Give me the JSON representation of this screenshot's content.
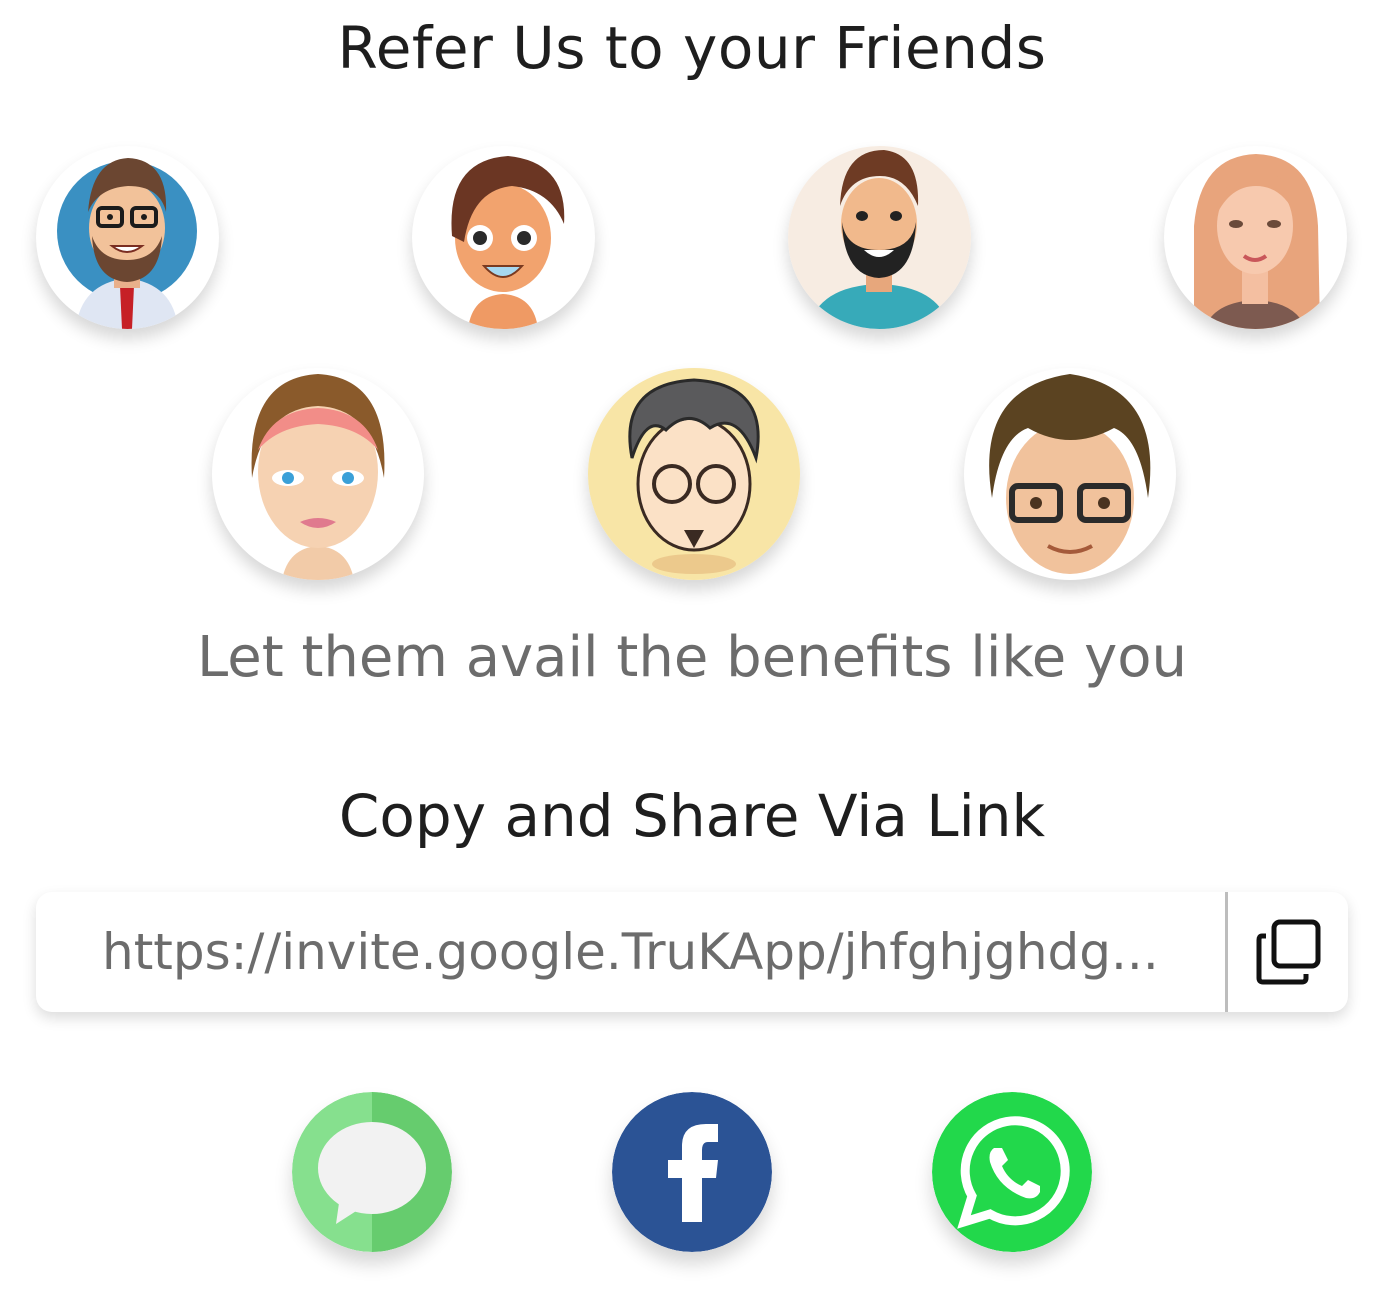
{
  "header": {
    "title": "Refer Us to your Friends"
  },
  "avatars": [
    {
      "name": "bearded-man-glasses-tie"
    },
    {
      "name": "smiling-boy"
    },
    {
      "name": "bearded-man-teal-shirt"
    },
    {
      "name": "blonde-woman"
    },
    {
      "name": "woman-pink-headband"
    },
    {
      "name": "man-round-glasses-goatee"
    },
    {
      "name": "curly-boy-glasses"
    }
  ],
  "subtitle": "Let them avail the benefits like you",
  "share": {
    "heading": "Copy and Share Via Link",
    "link": "https://invite.google.TruKApp/jhfghjghdg...",
    "copy_icon": "copy-icon",
    "buttons": [
      {
        "name": "messages-button",
        "icon": "message-bubble-icon",
        "color": "#66cc6e"
      },
      {
        "name": "facebook-button",
        "icon": "facebook-icon",
        "color": "#2b5395"
      },
      {
        "name": "whatsapp-button",
        "icon": "whatsapp-icon",
        "color": "#22d84b"
      }
    ]
  }
}
